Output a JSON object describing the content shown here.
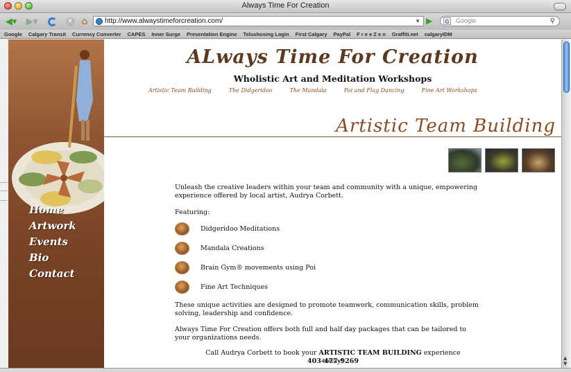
{
  "window": {
    "title": "Always Time For Creation"
  },
  "toolbar": {
    "url": "http://www.alwaystimeforcreation.com/",
    "search_placeholder": "Google"
  },
  "bookmarks": [
    "Google",
    "Calgary Transit",
    "Currency Converter",
    "CAPES",
    "Inner Surge",
    "Presentation Engine",
    "Telushosing Login",
    "First Calgary",
    "PayPal",
    "F r e e Z e n",
    "Graffiti.net",
    "calgaryIDM"
  ],
  "site": {
    "logo": "ALways Time For Creation",
    "tagline": "Wholistic Art and Meditation Workshops",
    "topnav": [
      "Artistic Team Building",
      "The Didgeridoo",
      "The Mandala",
      "Poi and Flag Dancing",
      "Fine Art Workshops"
    ],
    "sidenav": [
      "Home",
      "Artwork",
      "Events",
      "Bio",
      "Contact"
    ]
  },
  "main": {
    "title": "Artistic Team Building",
    "intro": "Unleash the creative leaders within your team and community with a unique, empowering experience offered by local artist, Audrya Corbett.",
    "featuring_label": "Featuring:",
    "features": [
      "Didgeridoo Meditations",
      "Mandala Creations",
      "Brain Gym® movements using Poi",
      "Fine Art Techniques"
    ],
    "para_activities": "These unique activities are designed to promote teamwork, communication skills, problem solving, leadership and confidence.",
    "para_packages": "Always Time For Creation offers both full and half day packages that can be tailored to your organizations needs.",
    "cta_pre": "Call Audrya Corbett to book your ",
    "cta_bold": "ARTISTIC TEAM BUILDING",
    "cta_post": " experience today!",
    "phone": "403-477-9269"
  },
  "colors": {
    "brown_accent": "#8a4a22",
    "sidebar": "#7a4426"
  }
}
